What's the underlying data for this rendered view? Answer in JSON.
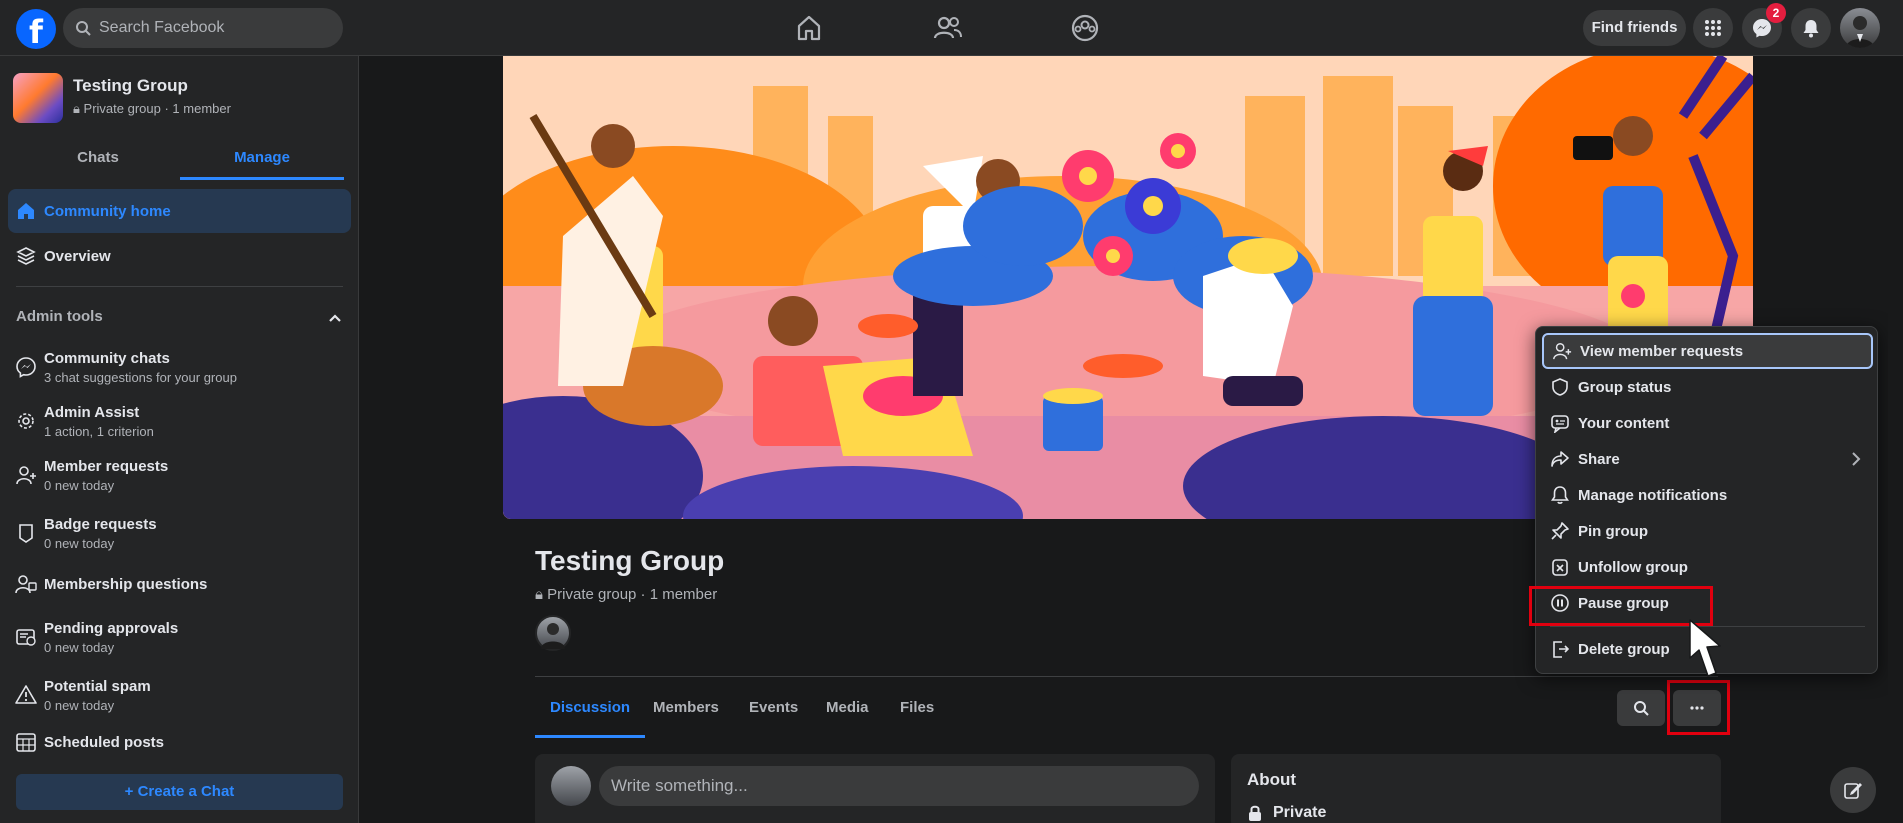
{
  "topbar": {
    "search_placeholder": "Search Facebook",
    "find_friends": "Find friends",
    "messenger_badge": "2"
  },
  "sidebar": {
    "group_name": "Testing Group",
    "group_meta": "Private group · 1 member",
    "tabs": [
      {
        "label": "Chats"
      },
      {
        "label": "Manage"
      }
    ],
    "community_home": "Community home",
    "overview": "Overview",
    "admin_tools": "Admin tools",
    "items": [
      {
        "label": "Community chats",
        "sub": "3 chat suggestions for your group"
      },
      {
        "label": "Admin Assist",
        "sub": "1 action, 1 criterion"
      },
      {
        "label": "Member requests",
        "sub": "0 new today"
      },
      {
        "label": "Badge requests",
        "sub": "0 new today"
      },
      {
        "label": "Membership questions",
        "sub": ""
      },
      {
        "label": "Pending approvals",
        "sub": "0 new today"
      },
      {
        "label": "Potential spam",
        "sub": "0 new today"
      },
      {
        "label": "Scheduled posts",
        "sub": ""
      }
    ],
    "create_chat": "+ Create a Chat"
  },
  "main": {
    "title": "Testing Group",
    "meta": "Private group · 1 member",
    "tabs": [
      {
        "label": "Discussion"
      },
      {
        "label": "Members"
      },
      {
        "label": "Events"
      },
      {
        "label": "Media"
      },
      {
        "label": "Files"
      }
    ],
    "compose_placeholder": "Write something...",
    "about_title": "About",
    "about_privacy": "Private"
  },
  "menu": {
    "items": [
      {
        "label": "View member requests"
      },
      {
        "label": "Group status"
      },
      {
        "label": "Your content"
      },
      {
        "label": "Share"
      },
      {
        "label": "Manage notifications"
      },
      {
        "label": "Pin group"
      },
      {
        "label": "Unfollow group"
      },
      {
        "label": "Pause group"
      },
      {
        "label": "Delete group"
      }
    ]
  }
}
